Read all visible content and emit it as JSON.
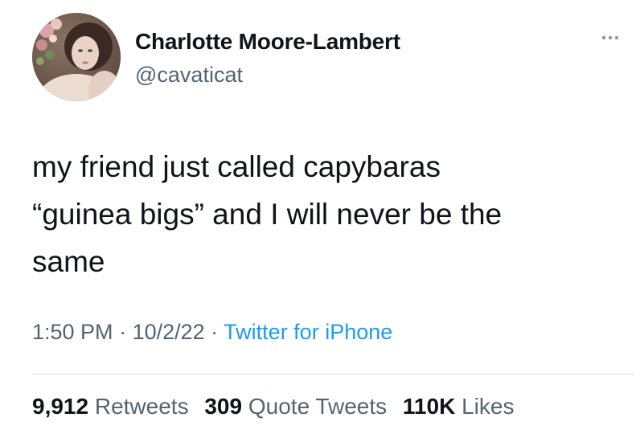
{
  "author": {
    "name": "Charlotte Moore-Lambert",
    "handle": "@cavaticat",
    "avatar_icon": "profile-photo"
  },
  "more_icon": "more-horizontal-icon",
  "tweet": {
    "text": "my friend just called capybaras\n“guinea bigs” and I will never be the\nsame"
  },
  "meta": {
    "time": "1:50 PM",
    "separator": " · ",
    "date": "10/2/22",
    "source": "Twitter for iPhone"
  },
  "stats": {
    "retweets_count": "9,912",
    "retweets_label": "Retweets",
    "quotes_count": "309",
    "quotes_label": "Quote Tweets",
    "likes_count": "110K",
    "likes_label": "Likes"
  },
  "colors": {
    "text": "#0f1419",
    "secondary": "#536471",
    "link": "#1d9bf0",
    "divider": "#d4d9dd"
  }
}
